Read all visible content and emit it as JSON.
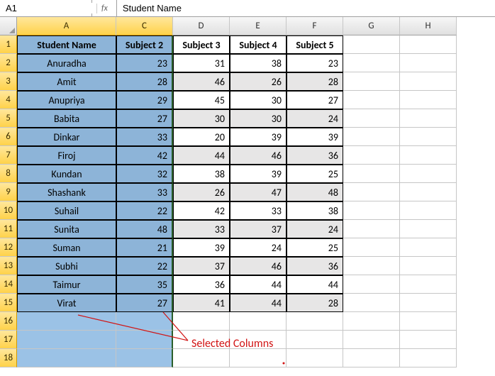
{
  "formula_bar": {
    "cell_ref": "A1",
    "fx_label": "fx",
    "formula_value": "Student Name"
  },
  "col_headers": [
    "A",
    "C",
    "D",
    "E",
    "F",
    "G",
    "H"
  ],
  "selected_col_indices": [
    0,
    1
  ],
  "headers": [
    "Student Name",
    "Subject 2",
    "Subject 3",
    "Subject 4",
    "Subject 5"
  ],
  "rows": [
    {
      "name": "Anuradha",
      "s2": 23,
      "s3": 31,
      "s4": 38,
      "s5": 23
    },
    {
      "name": "Amit",
      "s2": 28,
      "s3": 46,
      "s4": 26,
      "s5": 28
    },
    {
      "name": "Anupriya",
      "s2": 29,
      "s3": 45,
      "s4": 30,
      "s5": 27
    },
    {
      "name": "Babita",
      "s2": 27,
      "s3": 30,
      "s4": 30,
      "s5": 24
    },
    {
      "name": "Dinkar",
      "s2": 33,
      "s3": 20,
      "s4": 39,
      "s5": 39
    },
    {
      "name": "Firoj",
      "s2": 42,
      "s3": 44,
      "s4": 46,
      "s5": 36
    },
    {
      "name": "Kundan",
      "s2": 32,
      "s3": 38,
      "s4": 39,
      "s5": 25
    },
    {
      "name": "Shashank",
      "s2": 33,
      "s3": 26,
      "s4": 47,
      "s5": 48
    },
    {
      "name": "Suhail",
      "s2": 22,
      "s3": 42,
      "s4": 33,
      "s5": 38
    },
    {
      "name": "Sunita",
      "s2": 48,
      "s3": 33,
      "s4": 37,
      "s5": 24
    },
    {
      "name": "Suman",
      "s2": 21,
      "s3": 39,
      "s4": 24,
      "s5": 25
    },
    {
      "name": "Subhi",
      "s2": 22,
      "s3": 37,
      "s4": 46,
      "s5": 36
    },
    {
      "name": "Taimur",
      "s2": 35,
      "s3": 36,
      "s4": 44,
      "s5": 44
    },
    {
      "name": "Virat",
      "s2": 27,
      "s3": 41,
      "s4": 44,
      "s5": 28
    }
  ],
  "extra_rows": [
    16,
    17,
    18
  ],
  "annotation": {
    "text": "Selected Columns"
  }
}
